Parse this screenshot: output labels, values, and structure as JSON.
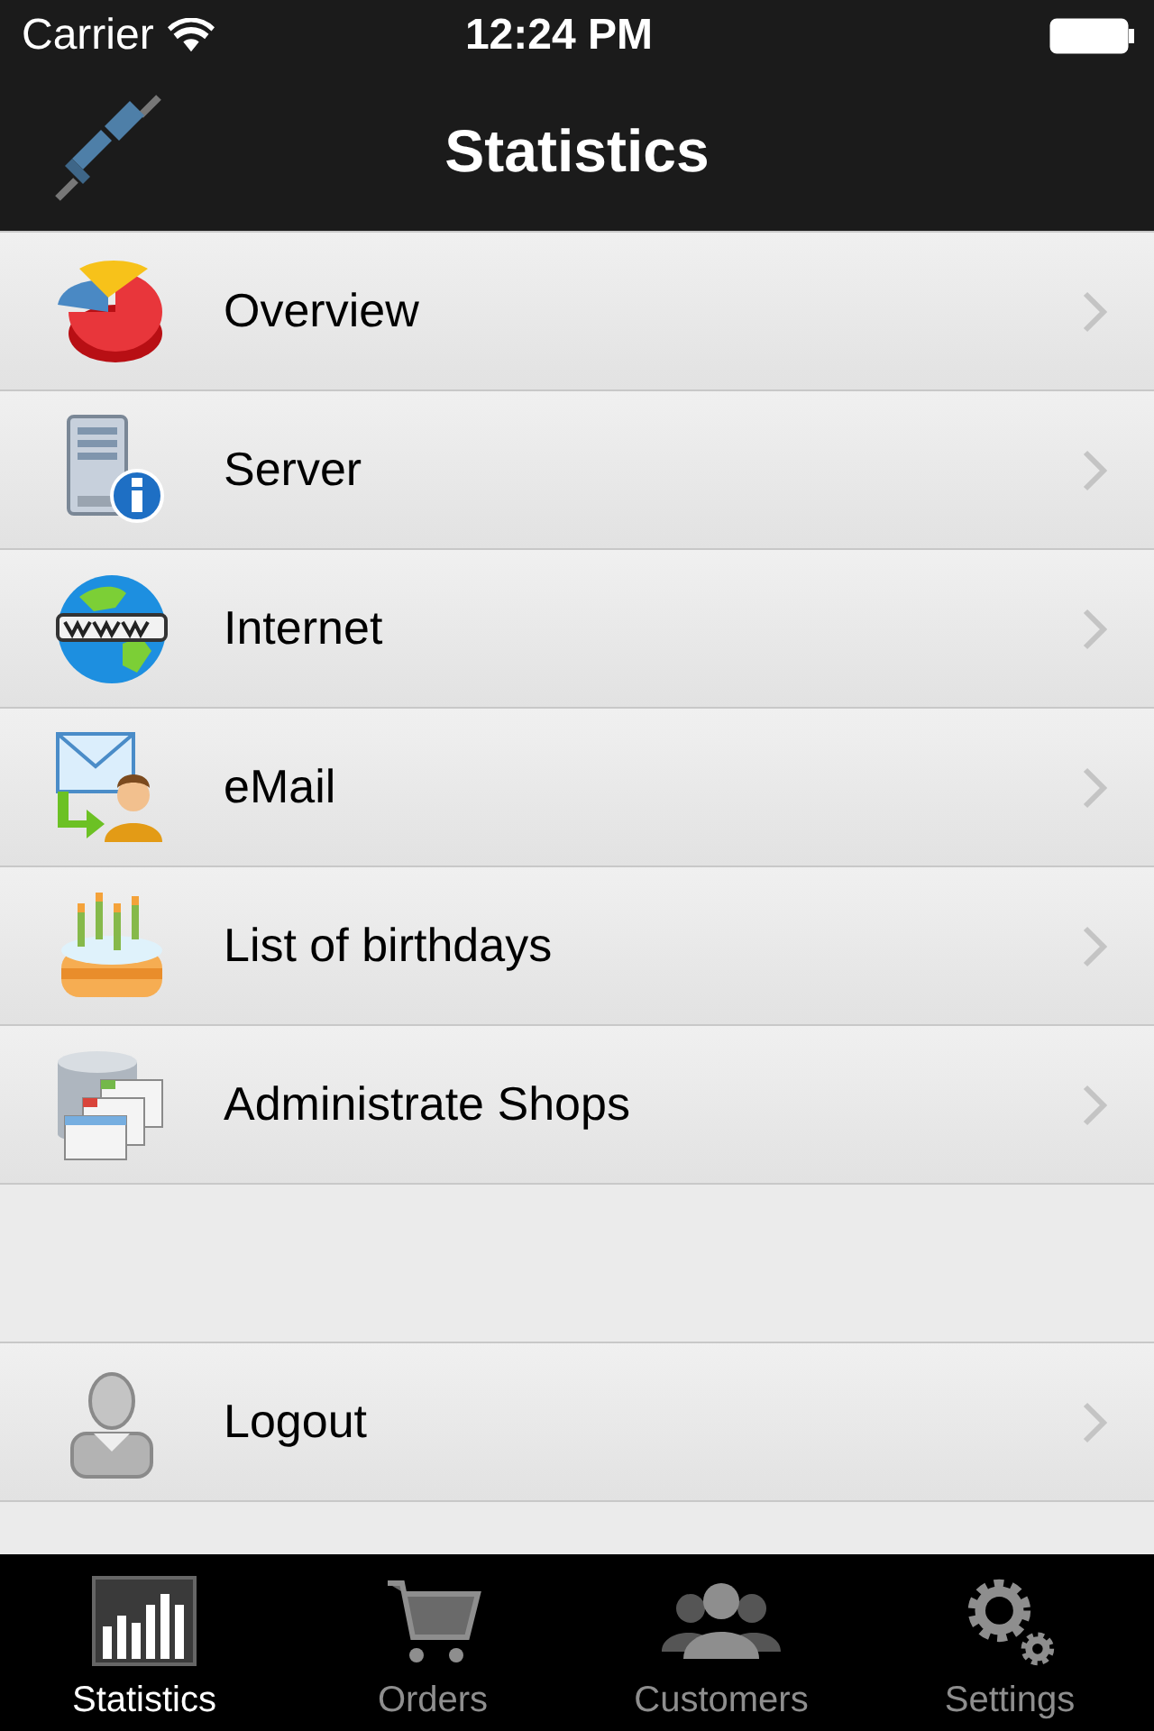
{
  "status_bar": {
    "carrier": "Carrier",
    "time": "12:24 PM"
  },
  "nav_bar": {
    "title": "Statistics"
  },
  "menu_groups": [
    {
      "items": [
        {
          "label": "Overview",
          "kind": "pie"
        },
        {
          "label": "Server",
          "kind": "server"
        },
        {
          "label": "Internet",
          "kind": "globe"
        },
        {
          "label": "eMail",
          "kind": "mail"
        },
        {
          "label": "List of birthdays",
          "kind": "cake"
        },
        {
          "label": "Administrate Shops",
          "kind": "database"
        }
      ]
    },
    {
      "items": [
        {
          "label": "Logout",
          "kind": "user"
        }
      ]
    }
  ],
  "tabs": [
    {
      "label": "Statistics",
      "kind": "chart",
      "selected": true
    },
    {
      "label": "Orders",
      "kind": "cart",
      "selected": false
    },
    {
      "label": "Customers",
      "kind": "people",
      "selected": false
    },
    {
      "label": "Settings",
      "kind": "gears",
      "selected": false
    }
  ]
}
